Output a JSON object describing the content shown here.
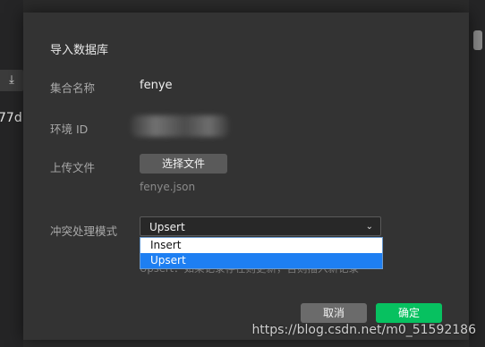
{
  "background": {
    "download_icon": "download-icon",
    "download_glyph": "⤓",
    "id_fragment": "77d"
  },
  "dialog": {
    "title": "导入数据库",
    "collection_label": "集合名称",
    "collection_value": "fenye",
    "env_label": "环境 ID",
    "upload_label": "上传文件",
    "choose_file_button": "选择文件",
    "file_name": "fenye.json",
    "conflict_label": "冲突处理模式",
    "conflict_selected": "Upsert",
    "conflict_chevron": "⌄",
    "conflict_options": [
      "Insert",
      "Upsert"
    ],
    "help_text": "Upsert：如果记录存在则更新，否则插入新记录",
    "cancel_button": "取消",
    "ok_button": "确定"
  },
  "watermark": "https://blog.csdn.net/m0_51592186",
  "colors": {
    "dialog_bg": "#333333",
    "ok_green": "#07c160",
    "selected_blue": "#1e7ff2"
  }
}
